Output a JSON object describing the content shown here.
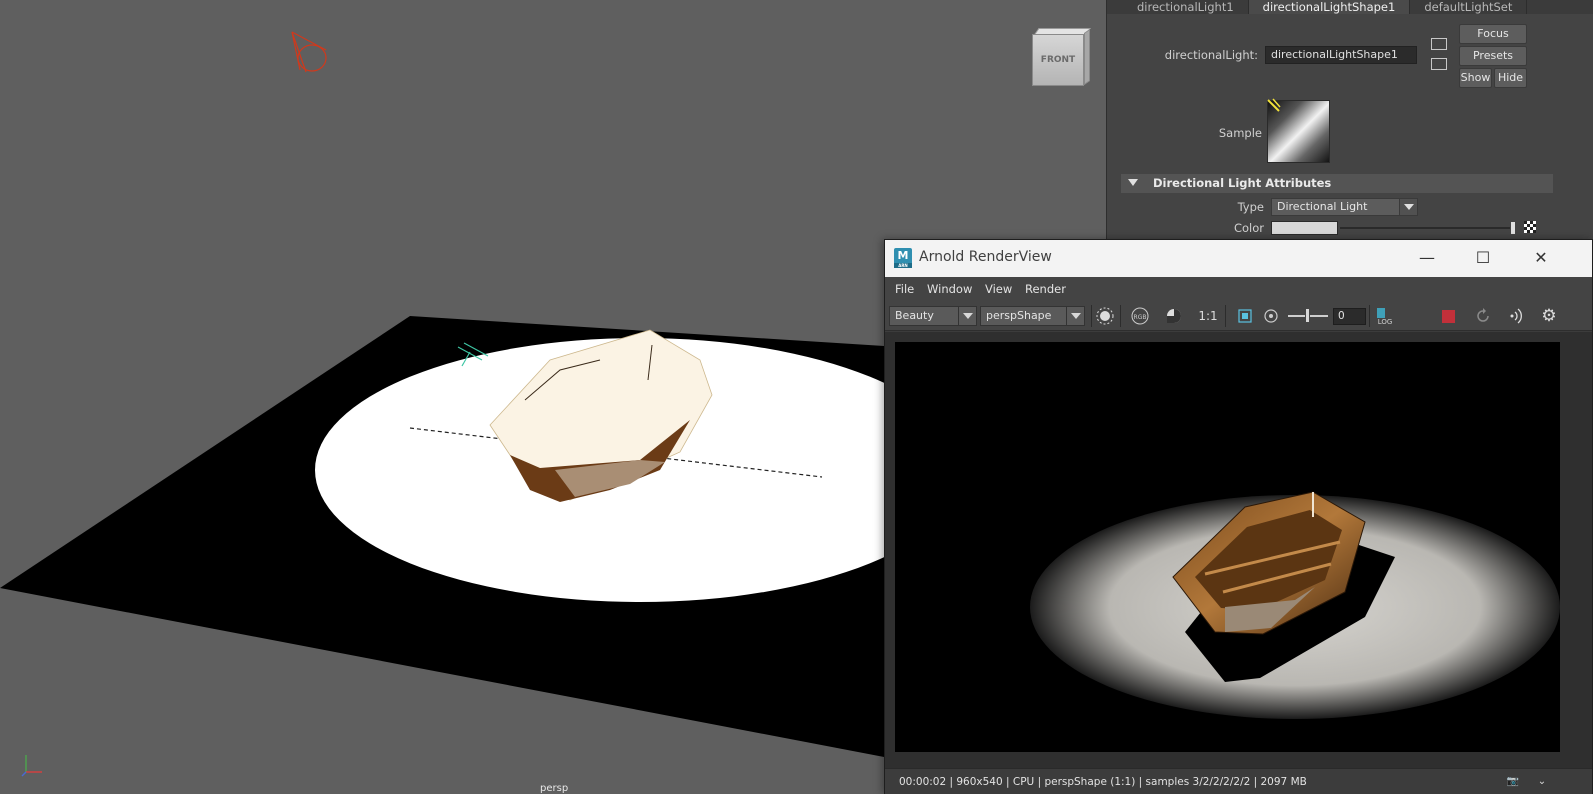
{
  "viewport": {
    "camera_label": "persp",
    "viewcube_label": "FRONT"
  },
  "attribute_editor": {
    "tabs": [
      {
        "label": "directionalLight1",
        "active": false
      },
      {
        "label": "directionalLightShape1",
        "active": true
      },
      {
        "label": "defaultLightSet",
        "active": false
      }
    ],
    "node_label": "directionalLight:",
    "node_value": "directionalLightShape1",
    "buttons": {
      "focus": "Focus",
      "presets": "Presets",
      "show": "Show",
      "hide": "Hide"
    },
    "sample_label": "Sample",
    "section_title": "Directional Light Attributes",
    "type_label": "Type",
    "type_value": "Directional Light",
    "color_label": "Color"
  },
  "render_view": {
    "title": "Arnold RenderView",
    "logo_text": "M",
    "logo_sub": "ARN",
    "menu": [
      "File",
      "Window",
      "View",
      "Render"
    ],
    "aov_value": "Beauty",
    "camera_value": "perspShape",
    "toolbar": {
      "rgb_label": "RGB",
      "ratio_label": "1:1",
      "exposure_value": "0",
      "log_label": "LOG"
    },
    "status_text": "00:00:02 | 960x540 | CPU | perspShape (1:1) | samples 3/2/2/2/2/2 | 2097 MB",
    "colors": {
      "stop": "#c2303a",
      "logo": "#2f8fb0"
    }
  }
}
